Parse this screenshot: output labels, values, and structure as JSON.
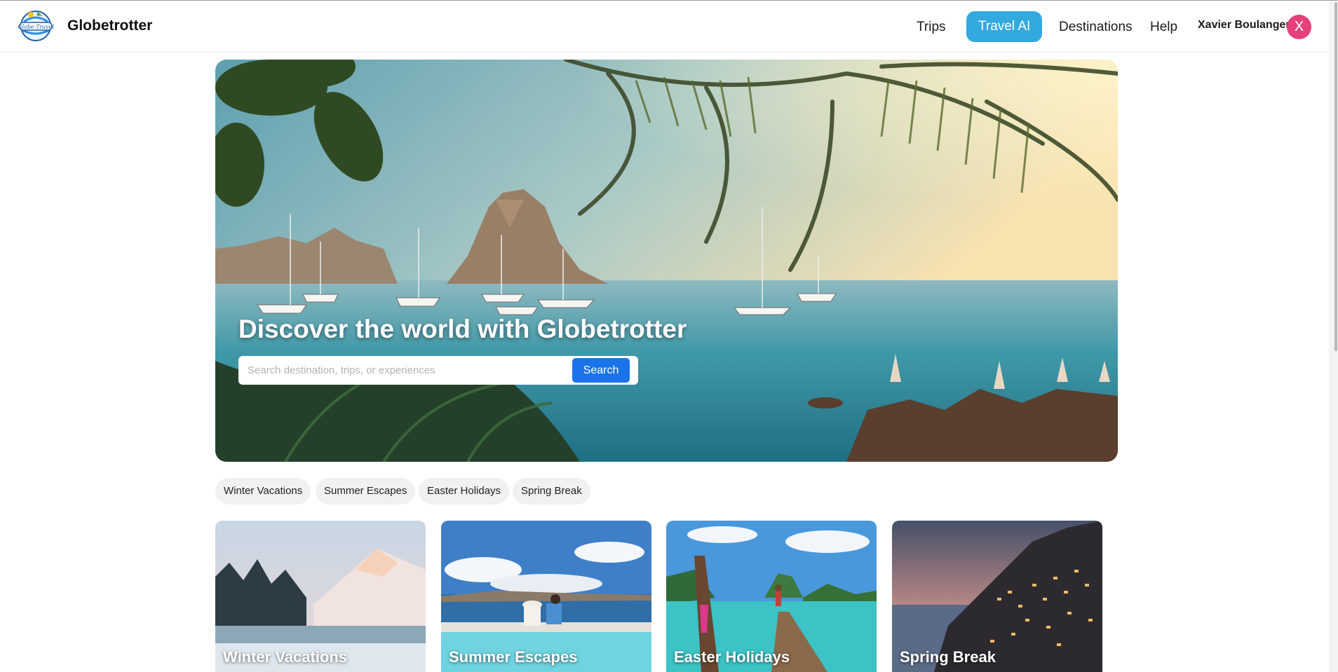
{
  "brand": {
    "name": "Globetrotter",
    "logo_icon": "globe-travel-logo-icon"
  },
  "nav": {
    "items": [
      {
        "label": "Trips",
        "active": false
      },
      {
        "label": "Travel AI",
        "active": true
      },
      {
        "label": "Destinations",
        "active": false
      },
      {
        "label": "Help",
        "active": false
      }
    ],
    "active_color": "#34a9de"
  },
  "user": {
    "name": "Xavier Boulanger",
    "initial": "X",
    "avatar_color": "#e5407a"
  },
  "hero": {
    "title": "Discover the world with Globetrotter",
    "search_placeholder": "Search destination, trips, or experiences",
    "search_value": "",
    "search_button": "Search",
    "search_button_color": "#1a73e8"
  },
  "filters": [
    "Winter Vacations",
    "Summer Escapes",
    "Easter Holidays",
    "Spring Break"
  ],
  "cards": [
    {
      "title": "Winter Vacations",
      "scene": "snowy-mountain-lake"
    },
    {
      "title": "Summer Escapes",
      "scene": "couple-by-pool-sea"
    },
    {
      "title": "Easter Holidays",
      "scene": "tropical-longboat-pier"
    },
    {
      "title": "Spring Break",
      "scene": "coastal-cliff-village-dusk"
    }
  ]
}
